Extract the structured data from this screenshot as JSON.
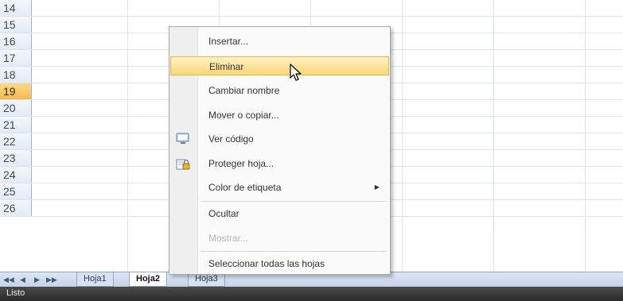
{
  "rows": [
    "14",
    "15",
    "16",
    "17",
    "18",
    "19",
    "20",
    "21",
    "22",
    "23",
    "24",
    "25",
    "26"
  ],
  "active_row": "19",
  "sheet_tabs": [
    "Hoja1",
    "Hoja2",
    "Hoja3"
  ],
  "active_tab": "Hoja2",
  "status_text": "Listo",
  "context_menu": {
    "items": [
      {
        "label": "Insertar...",
        "state": "normal"
      },
      {
        "label": "Eliminar",
        "state": "highlighted"
      },
      {
        "label": "Cambiar nombre",
        "state": "normal"
      },
      {
        "label": "Mover o copiar...",
        "state": "normal"
      },
      {
        "label": "Ver código",
        "state": "normal",
        "icon": "view-code-icon"
      },
      {
        "label": "Proteger hoja...",
        "state": "normal",
        "icon": "protect-sheet-icon"
      },
      {
        "label": "Color de etiqueta",
        "state": "normal",
        "submenu": true
      },
      {
        "label": "Ocultar",
        "state": "normal"
      },
      {
        "label": "Mostrar...",
        "state": "disabled"
      },
      {
        "label": "Seleccionar todas las hojas",
        "state": "normal"
      }
    ]
  },
  "colors": {
    "menu_highlight": "#fcd876",
    "active_row_header": "#f6b94a",
    "grid_line": "#dbe3ee"
  }
}
